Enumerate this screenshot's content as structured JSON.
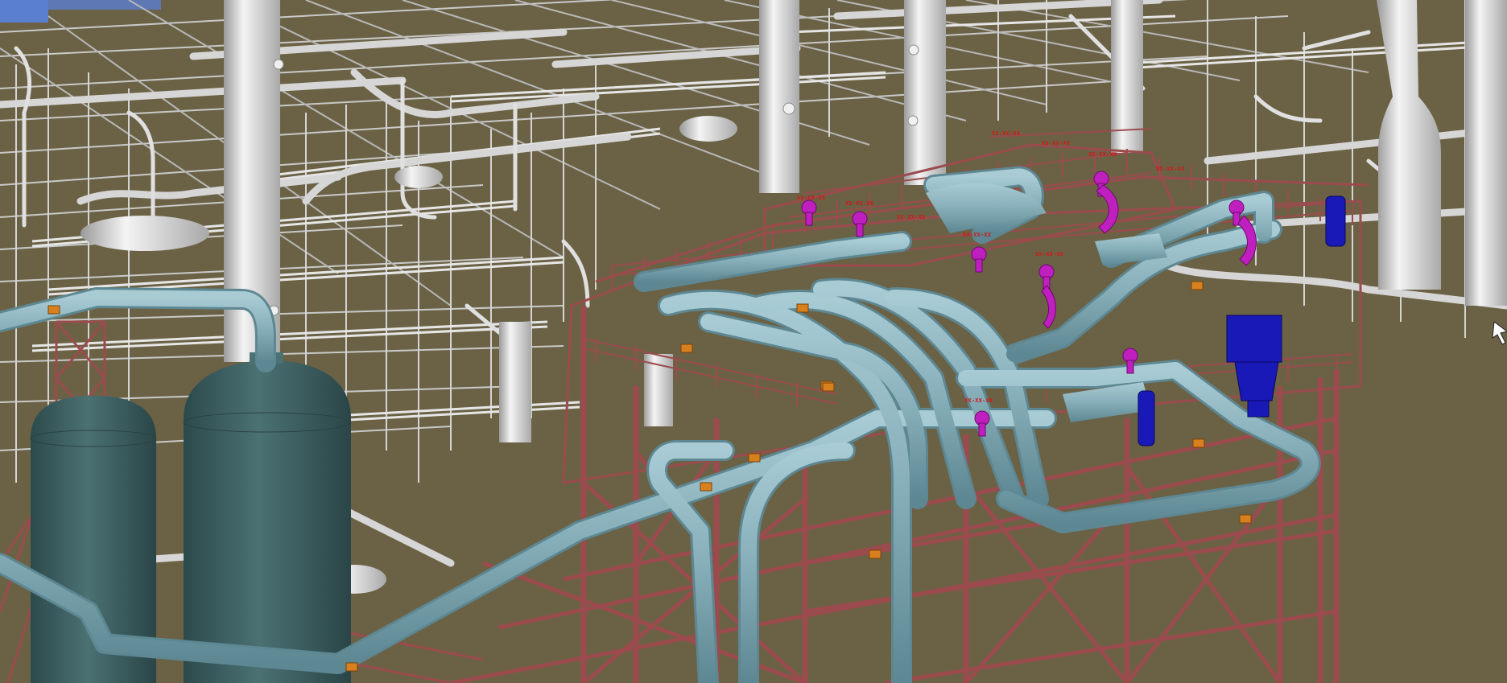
{
  "viewer": {
    "mode": "3D plant model viewport",
    "background_color": "#6b6245"
  },
  "palette": {
    "context_steel": "#c9c9c9",
    "context_shadow": "#8f8f8f",
    "selected_steel": "#9b4b4d",
    "process_pipe": "#8fb7c2",
    "vessel": "#3f6163",
    "valve": "#c01fc0",
    "equipment_blue": "#1919b8",
    "support_orange": "#d8801e",
    "tag_red": "#d11818"
  },
  "tags": [
    {
      "id": "t1",
      "text": "XX-XX-XX"
    },
    {
      "id": "t2",
      "text": "XX-XX-XX"
    },
    {
      "id": "t3",
      "text": "XX-XX-XX"
    },
    {
      "id": "t4",
      "text": "XX-XX-XX"
    },
    {
      "id": "t5",
      "text": "XX-XX-XX"
    },
    {
      "id": "t6",
      "text": "XX-XX-XX"
    },
    {
      "id": "t7",
      "text": "XX-XX-XX"
    },
    {
      "id": "t8",
      "text": "XX-XX-XX"
    },
    {
      "id": "t9",
      "text": "XX-XX-XX"
    },
    {
      "id": "t10",
      "text": "XX-XX-XX"
    }
  ],
  "scene_objects": [
    "context-structure",
    "grey-columns",
    "grey-pipe-rack",
    "selected-structure",
    "process-pipes",
    "vessel-left",
    "vessel-right",
    "red-tower",
    "valves",
    "blue-equipment",
    "pipe-supports",
    "tag-labels",
    "cursor-icon"
  ]
}
